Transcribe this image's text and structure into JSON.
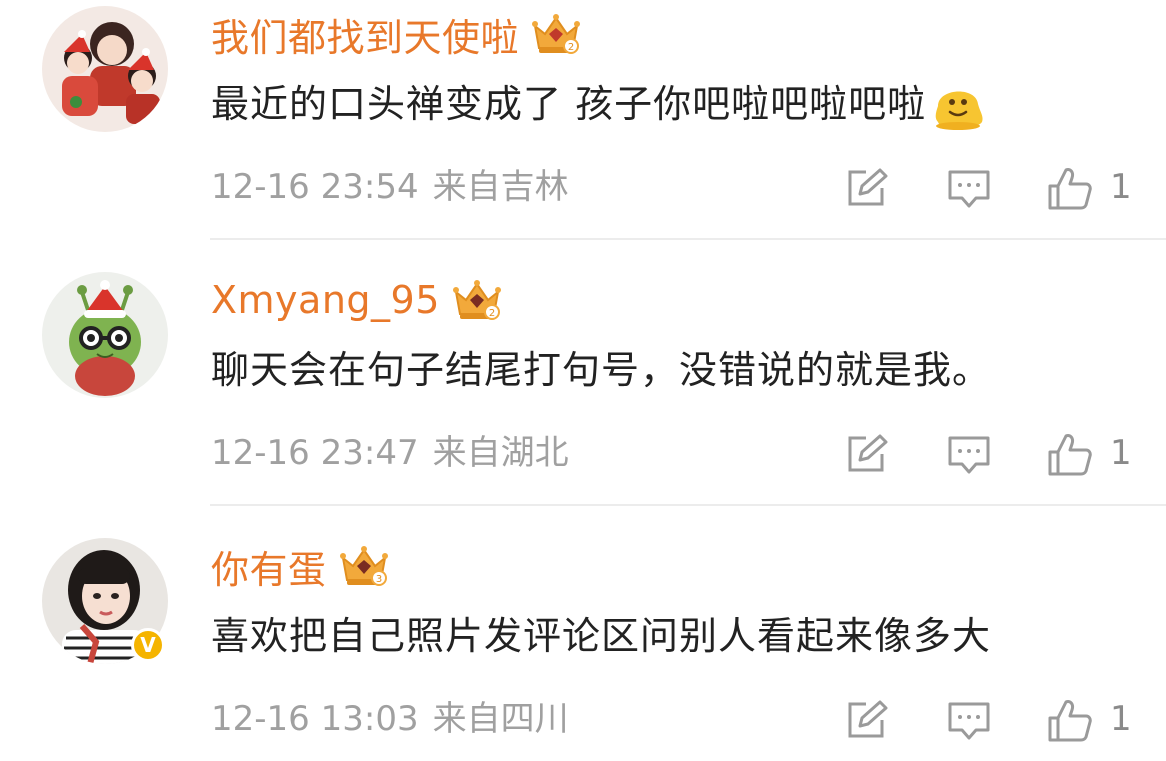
{
  "comments": [
    {
      "username": "我们都找到天使啦",
      "badge_level": "2",
      "verified": false,
      "text": "最近的口头禅变成了 孩子你吧啦吧啦吧啦",
      "has_emoji": true,
      "date": "12-16 23:54",
      "location": "来自吉林",
      "likes": "1"
    },
    {
      "username": "Xmyang_95",
      "badge_level": "2",
      "verified": false,
      "text": "聊天会在句子结尾打句号，没错说的就是我。",
      "has_emoji": false,
      "date": "12-16 23:47",
      "location": "来自湖北",
      "likes": "1"
    },
    {
      "username": "你有蛋",
      "badge_level": "3",
      "verified": true,
      "verified_label": "V",
      "text": "喜欢把自己照片发评论区问别人看起来像多大",
      "has_emoji": false,
      "date": "12-16 13:03",
      "location": "来自四川",
      "likes": "1"
    }
  ],
  "icons": {
    "crown": "crown-badge-icon",
    "emoji": "melting-face-emoji",
    "edit": "edit-icon",
    "reply": "comment-icon",
    "like": "thumbs-up-icon"
  },
  "colors": {
    "username": "#e8782a",
    "text": "#222222",
    "meta": "#a0a0a0",
    "icon": "#9a9a9a",
    "crown_gold": "#f2a93b",
    "crown_gem": "#c0392b",
    "verified": "#f5b400"
  }
}
